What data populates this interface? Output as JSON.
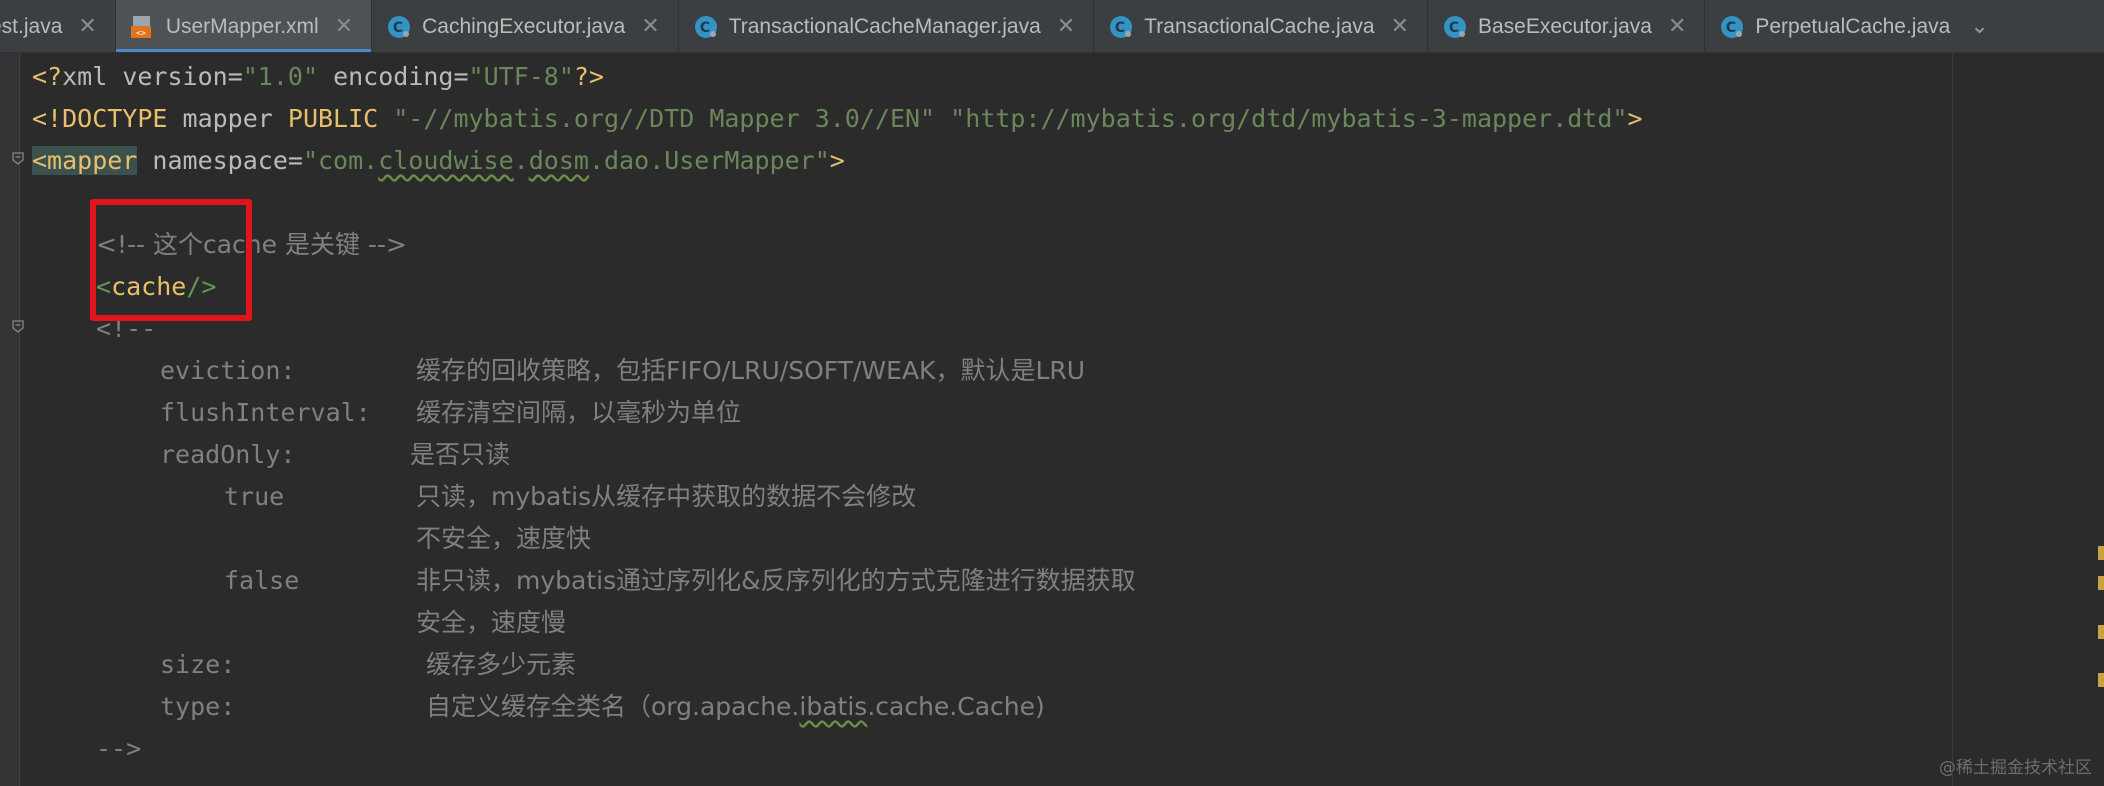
{
  "tabs": [
    {
      "label": "est.java",
      "icon": "java-file-icon",
      "partial": true
    },
    {
      "label": "UserMapper.xml",
      "icon": "xml-file-icon",
      "active": true
    },
    {
      "label": "CachingExecutor.java",
      "icon": "java-class-icon"
    },
    {
      "label": "TransactionalCacheManager.java",
      "icon": "java-class-icon"
    },
    {
      "label": "TransactionalCache.java",
      "icon": "java-class-icon"
    },
    {
      "label": "BaseExecutor.java",
      "icon": "java-class-icon"
    },
    {
      "label": "PerpetualCache.java",
      "icon": "java-class-icon"
    }
  ],
  "tab_overflow_icon": "chevron-down-icon",
  "code": {
    "l1": {
      "a": "<?",
      "b": "xml version",
      "c": "=",
      "d": "\"1.0\"",
      "e": " encoding",
      "f": "=",
      "g": "\"UTF-8\"",
      "h": "?>"
    },
    "l2": {
      "a": "<!DOCTYPE",
      "b": " mapper ",
      "c": "PUBLIC",
      "d": " \"-//mybatis.org//DTD Mapper 3.0//EN\" \"http://mybatis.org/dtd/mybatis-3-mapper.dtd\"",
      "e": ">"
    },
    "l3": {
      "a": "<mapper",
      "b": " namespace",
      "c": "=",
      "d1": "\"com.",
      "d2": "cloudwise",
      "d3": ".",
      "d4": "dosm",
      "d5": ".dao.UserMapper\"",
      "e": ">"
    },
    "l5": "<!-- 这个cache 是关键 -->",
    "l6": {
      "a": "<",
      "b": "cache",
      "c": "/>"
    },
    "l7": "<!--",
    "l8": {
      "key": "eviction:",
      "desc": "缓存的回收策略，包括FIFO/LRU/SOFT/WEAK，默认是LRU"
    },
    "l9": {
      "key": "flushInterval:",
      "desc": "缓存清空间隔，以毫秒为单位"
    },
    "l10": {
      "key": "readOnly:",
      "desc": "是否只读"
    },
    "l11": {
      "key": "true",
      "desc": "只读，mybatis从缓存中获取的数据不会修改"
    },
    "l12": {
      "desc": "不安全，速度快"
    },
    "l13": {
      "key": "false",
      "desc": "非只读，mybatis通过序列化&反序列化的方式克隆进行数据获取"
    },
    "l14": {
      "desc": "安全，速度慢"
    },
    "l15": {
      "key": "size:",
      "desc": "缓存多少元素"
    },
    "l16": {
      "key": "type:",
      "desc1": "自定义缓存全类名（org.apache.",
      "desc2": "ibatis",
      "desc3": ".cache.Cache)"
    },
    "l17": "-->"
  },
  "watermark": "@稀土掘金技术社区",
  "colors": {
    "highlight_box": "#e3131b",
    "active_tab_underline": "#4a88c7",
    "editor_bg": "#2b2b2b"
  }
}
